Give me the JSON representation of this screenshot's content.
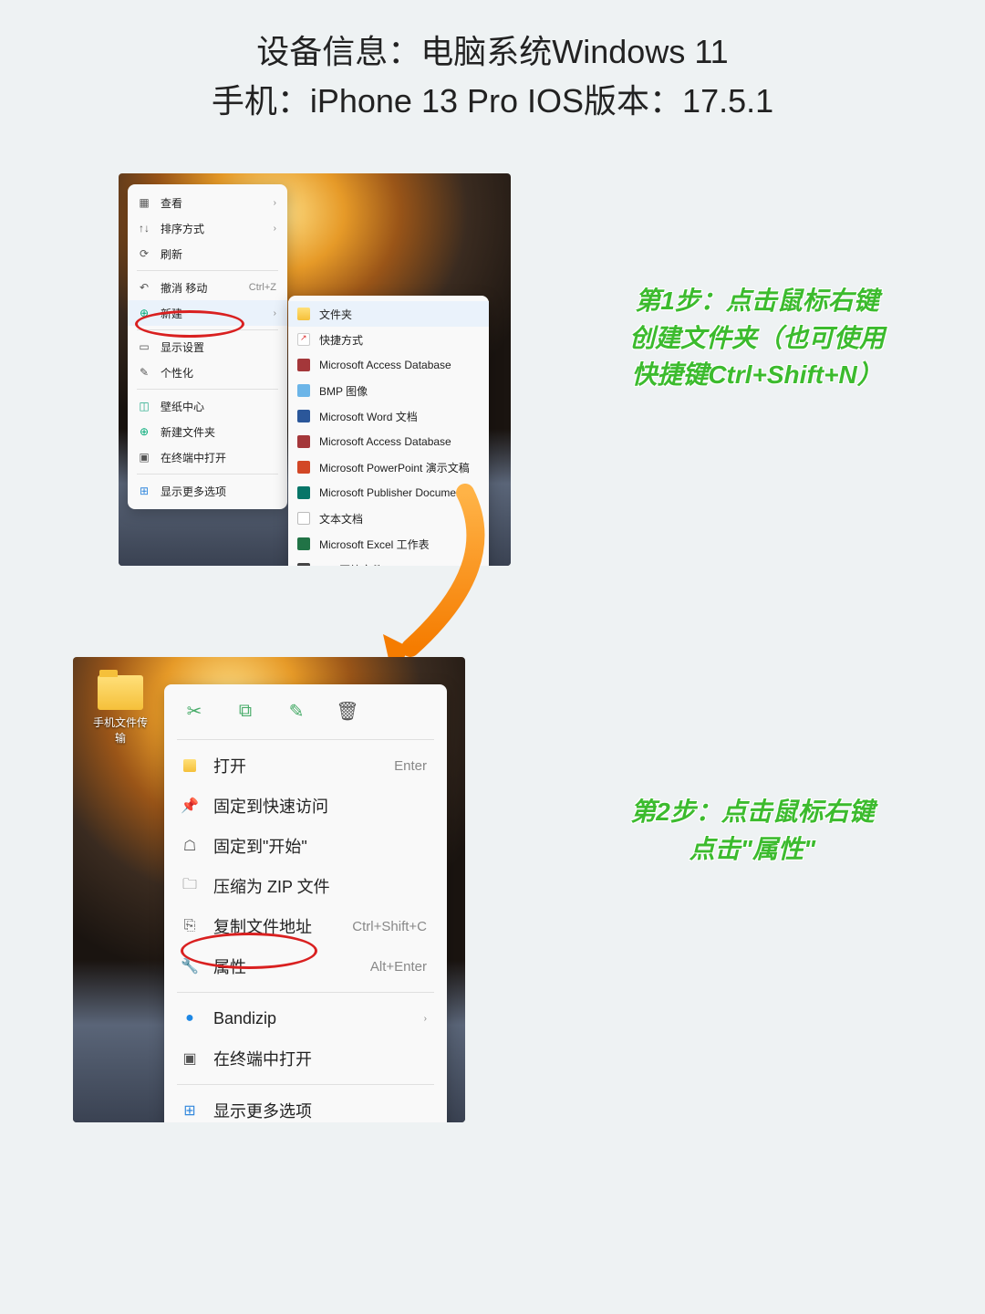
{
  "header": {
    "line1": "设备信息：电脑系统Windows 11",
    "line2": "手机：iPhone 13 Pro  IOS版本：17.5.1"
  },
  "menu1": {
    "view": "查看",
    "sort": "排序方式",
    "refresh": "刷新",
    "undo_move": "撤消 移动",
    "undo_sc": "Ctrl+Z",
    "new": "新建",
    "display_settings": "显示设置",
    "personalize": "个性化",
    "wallpaper_center": "壁纸中心",
    "new_folder_quick": "新建文件夹",
    "open_terminal": "在终端中打开",
    "more_options": "显示更多选项"
  },
  "submenu1": {
    "folder": "文件夹",
    "shortcut": "快捷方式",
    "access1": "Microsoft Access Database",
    "bmp": "BMP 图像",
    "word": "Microsoft Word 文档",
    "access2": "Microsoft Access Database",
    "ppt": "Microsoft PowerPoint 演示文稿",
    "pub": "Microsoft Publisher Document",
    "txt": "文本文档",
    "excel": "Microsoft Excel 工作表",
    "zip": "ZIP 压缩文件"
  },
  "step1": {
    "l1": "第1步：点击鼠标右键",
    "l2": "创建文件夹（也可使用",
    "l3": "快捷键Ctrl+Shift+N）"
  },
  "folder_label": "手机文件传输",
  "menu2": {
    "open": "打开",
    "open_sc": "Enter",
    "pin_quick": "固定到快速访问",
    "pin_start": "固定到\"开始\"",
    "zip": "压缩为 ZIP 文件",
    "copy_path": "复制文件地址",
    "copy_path_sc": "Ctrl+Shift+C",
    "properties": "属性",
    "properties_sc": "Alt+Enter",
    "bandizip": "Bandizip",
    "open_terminal": "在终端中打开",
    "more_options": "显示更多选项"
  },
  "step2": {
    "l1": "第2步：点击鼠标右键",
    "l2": "点击\"属性\""
  }
}
